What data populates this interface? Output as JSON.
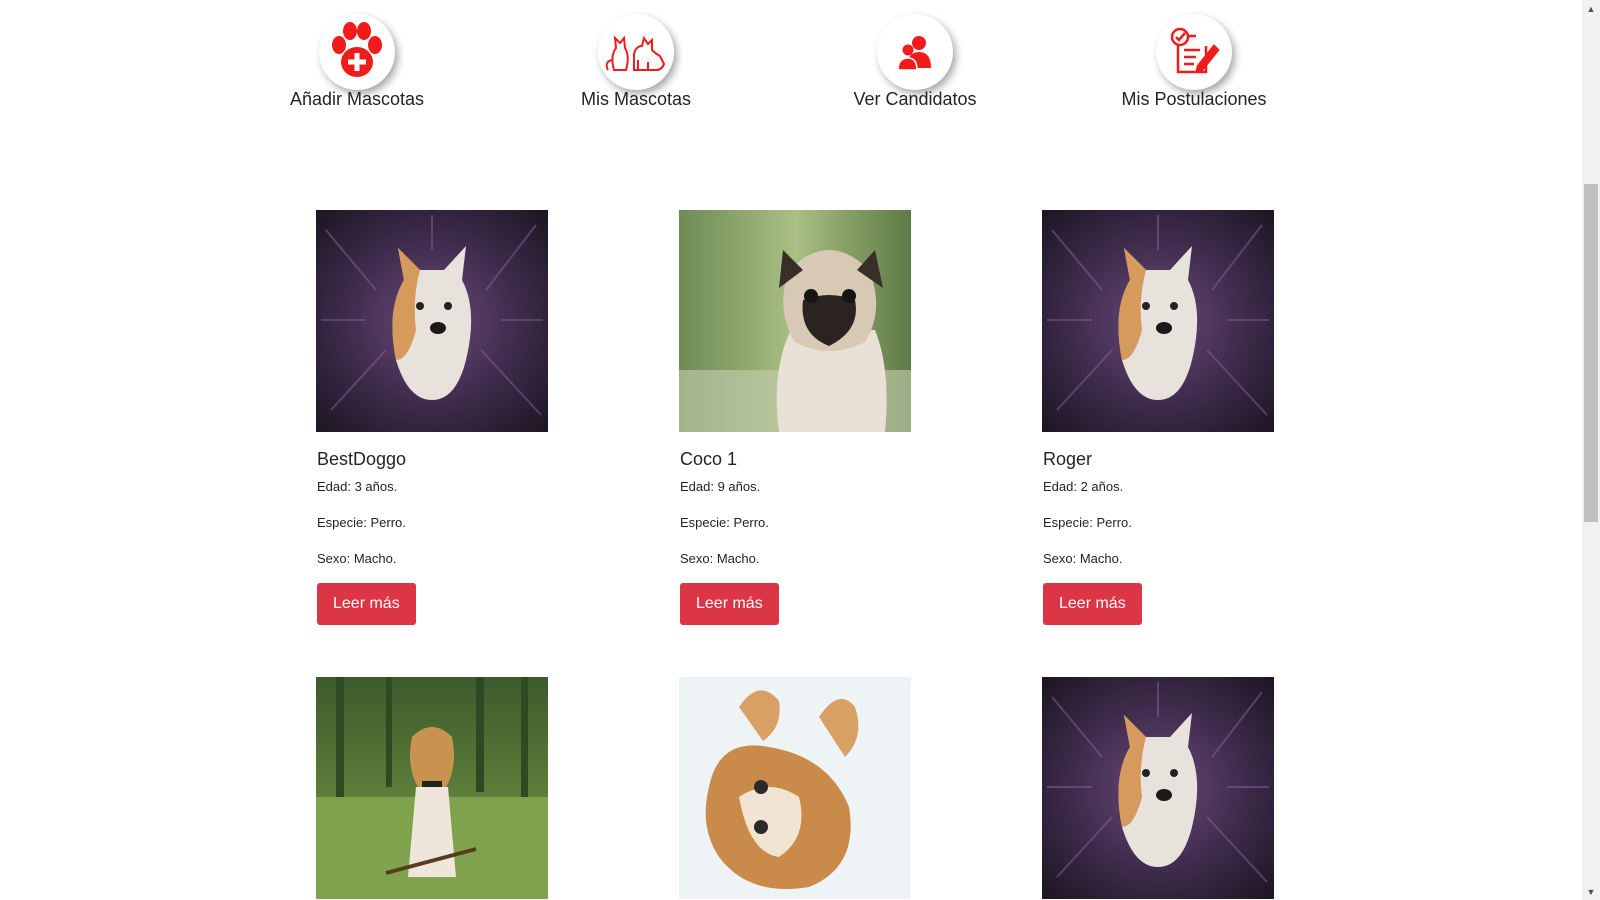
{
  "nav": [
    {
      "label": "Añadir Mascotas",
      "icon": "paw-plus-icon"
    },
    {
      "label": "Mis Mascotas",
      "icon": "cat-dog-icon"
    },
    {
      "label": "Ver Candidatos",
      "icon": "users-icon"
    },
    {
      "label": "Mis Postulaciones",
      "icon": "checklist-icon"
    }
  ],
  "accent_color": "#dc3545",
  "icon_color": "#f01c1c",
  "pets": [
    {
      "name": "BestDoggo",
      "edad": "Edad: 3 años.",
      "especie": "Especie: Perro.",
      "sexo": "Sexo: Macho.",
      "button": "Leer más",
      "photo": "akita-dog-photo"
    },
    {
      "name": "Coco 1",
      "edad": "Edad: 9 años.",
      "especie": "Especie: Perro.",
      "sexo": "Sexo: Macho.",
      "button": "Leer más",
      "photo": "pug-dog-photo"
    },
    {
      "name": "Roger",
      "edad": "Edad: 2 años.",
      "especie": "Especie: Perro.",
      "sexo": "Sexo: Macho.",
      "button": "Leer más",
      "photo": "akita-dog-photo"
    },
    {
      "photo": "labrador-dog-photo"
    },
    {
      "photo": "kitten-photo"
    },
    {
      "photo": "akita-dog-photo"
    }
  ]
}
